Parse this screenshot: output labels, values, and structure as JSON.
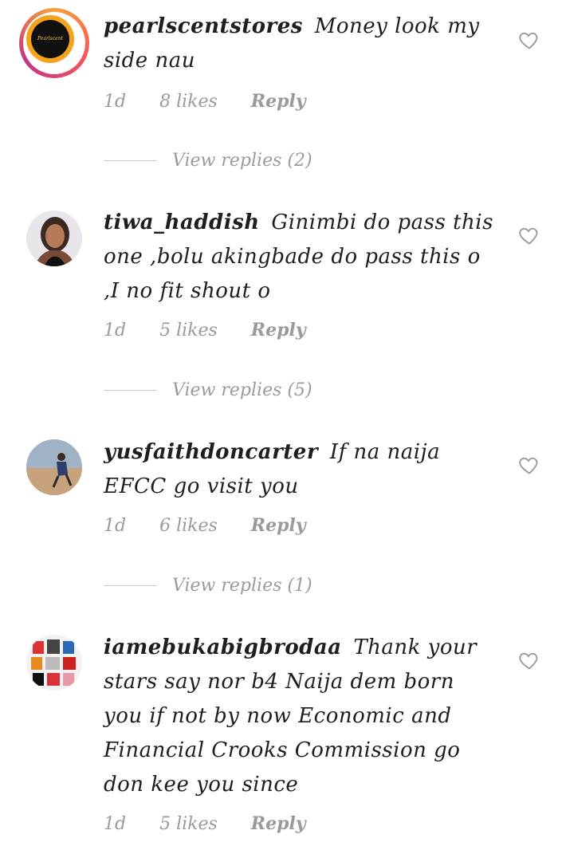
{
  "comments": [
    {
      "username": "pearlscentstores",
      "text": "Money look my side nau",
      "time": "1d",
      "likes": "8 likes",
      "reply_label": "Reply",
      "avatar_logo_text": "Pearlscent",
      "view_replies": "View replies (2)"
    },
    {
      "username": "tiwa_haddish",
      "text": "Ginimbi do pass this one ,bolu akingbade do pass this o ,I  no fit shout o",
      "time": "1d",
      "likes": "5 likes",
      "reply_label": "Reply",
      "view_replies": "View replies (5)"
    },
    {
      "username": "yusfaithdoncarter",
      "text": "If na naija EFCC go visit you",
      "time": "1d",
      "likes": "6 likes",
      "reply_label": "Reply",
      "view_replies": "View replies (1)"
    },
    {
      "username": "iamebukabigbrodaa",
      "text": "Thank your stars say nor b4 Naija dem born you if not by now Economic and Financial Crooks Commission go don kee you since",
      "time": "1d",
      "likes": "5 likes",
      "reply_label": "Reply"
    }
  ],
  "colors": {
    "meta_gray": "#9a9a9a",
    "ring_gradient": [
      "#f9a23a",
      "#f5515f",
      "#c13584"
    ],
    "logo_orange": "#f6a21c"
  },
  "icons": {
    "like": "heart-outline-icon"
  }
}
